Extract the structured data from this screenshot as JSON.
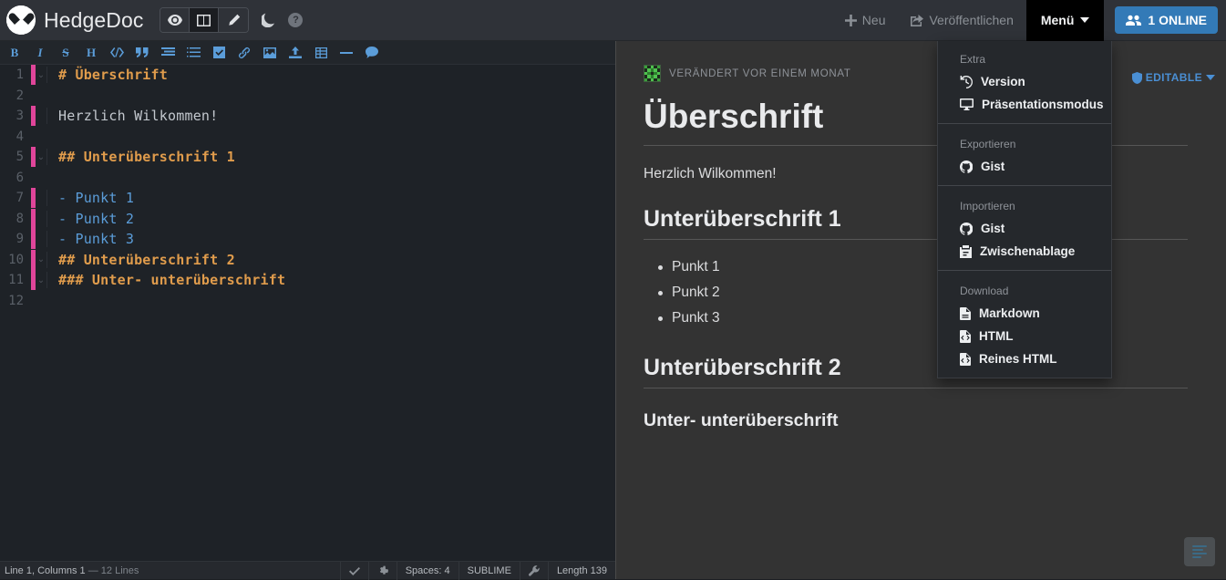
{
  "header": {
    "brand": "HedgeDoc",
    "view_modes": [
      {
        "name": "view-mode-preview",
        "icon": "eye-icon",
        "active": false
      },
      {
        "name": "view-mode-both",
        "icon": "columns-icon",
        "active": true
      },
      {
        "name": "view-mode-edit",
        "icon": "pencil-icon",
        "active": false
      }
    ],
    "night_mode_icon": "moon-icon",
    "help_icon": "question-circle-icon",
    "new_label": "Neu",
    "publish_label": "Veröffentlichen",
    "menu_label": "Menü",
    "online_label": "1 ONLINE",
    "accent_color": "#337ab7"
  },
  "dropdown": {
    "sections": [
      {
        "header": "Extra",
        "items": [
          {
            "label": "Version",
            "icon": "history-icon"
          },
          {
            "label": "Präsentationsmodus",
            "icon": "desktop-icon"
          }
        ]
      },
      {
        "header": "Exportieren",
        "items": [
          {
            "label": "Gist",
            "icon": "github-icon"
          }
        ]
      },
      {
        "header": "Importieren",
        "items": [
          {
            "label": "Gist",
            "icon": "github-icon"
          },
          {
            "label": "Zwischenablage",
            "icon": "clipboard-icon"
          }
        ]
      },
      {
        "header": "Download",
        "items": [
          {
            "label": "Markdown",
            "icon": "file-text-icon"
          },
          {
            "label": "HTML",
            "icon": "file-code-icon"
          },
          {
            "label": "Reines HTML",
            "icon": "file-code-icon"
          }
        ]
      }
    ]
  },
  "toolbar": {
    "buttons": [
      {
        "name": "bold-icon",
        "glyph": "B"
      },
      {
        "name": "italic-icon",
        "glyph": "I"
      },
      {
        "name": "strikethrough-icon",
        "glyph": "S"
      },
      {
        "name": "heading-icon",
        "glyph": "H"
      },
      {
        "name": "code-icon",
        "glyph": "</>"
      },
      {
        "name": "quote-icon",
        "glyph": "”"
      },
      {
        "name": "unordered-list-icon",
        "glyph": ""
      },
      {
        "name": "ordered-list-icon",
        "glyph": ""
      },
      {
        "name": "checkbox-icon",
        "glyph": ""
      },
      {
        "name": "link-icon",
        "glyph": ""
      },
      {
        "name": "image-icon",
        "glyph": ""
      },
      {
        "name": "upload-icon",
        "glyph": ""
      },
      {
        "name": "table-icon",
        "glyph": ""
      },
      {
        "name": "horizontal-rule-icon",
        "glyph": ""
      },
      {
        "name": "comment-icon",
        "glyph": ""
      }
    ]
  },
  "editor": {
    "lines": [
      {
        "n": "1",
        "text": "# Überschrift",
        "type": "heading",
        "modified": true,
        "fold": true
      },
      {
        "n": "2",
        "text": "",
        "type": "text",
        "modified": false,
        "fold": false
      },
      {
        "n": "3",
        "text": "Herzlich Wilkommen!",
        "type": "text",
        "modified": true,
        "fold": false
      },
      {
        "n": "4",
        "text": "",
        "type": "text",
        "modified": false,
        "fold": false
      },
      {
        "n": "5",
        "text": "## Unterüberschrift 1",
        "type": "heading",
        "modified": true,
        "fold": true
      },
      {
        "n": "6",
        "text": "",
        "type": "text",
        "modified": false,
        "fold": false
      },
      {
        "n": "7",
        "text": "- Punkt 1",
        "type": "list",
        "modified": true,
        "fold": false
      },
      {
        "n": "8",
        "text": "- Punkt 2",
        "type": "list",
        "modified": true,
        "fold": false
      },
      {
        "n": "9",
        "text": "- Punkt 3",
        "type": "list",
        "modified": true,
        "fold": false
      },
      {
        "n": "10",
        "text": "## Unterüberschrift 2",
        "type": "heading",
        "modified": true,
        "fold": true
      },
      {
        "n": "11",
        "text": "### Unter- unterüberschrift",
        "type": "heading",
        "modified": true,
        "fold": true
      },
      {
        "n": "12",
        "text": "",
        "type": "text",
        "modified": false,
        "fold": false
      }
    ]
  },
  "statusbar": {
    "cursor": "Line 1, Columns 1",
    "lines_count": "— 12 Lines",
    "check_icon": "check-icon",
    "gear_icon": "gear-icon",
    "spaces": "Spaces: 4",
    "keymap": "SUBLIME",
    "wrench_icon": "wrench-icon",
    "length": "Length 139"
  },
  "preview": {
    "modified_text": "VERÄNDERT VOR EINEM MONAT",
    "avatar": "identicon-avatar",
    "permission_badge": "EDITABLE",
    "permission_icon": "shield-icon",
    "toc_button": "table-of-contents-icon",
    "blocks": [
      {
        "tag": "h1",
        "text": "Überschrift"
      },
      {
        "tag": "p",
        "text": "Herzlich Wilkommen!"
      },
      {
        "tag": "h2",
        "text": "Unterüberschrift 1"
      },
      {
        "tag": "ul",
        "items": [
          "Punkt 1",
          "Punkt 2",
          "Punkt 3"
        ]
      },
      {
        "tag": "h2",
        "text": "Unterüberschrift 2"
      },
      {
        "tag": "h3",
        "text": "Unter- unterüberschrift"
      }
    ]
  }
}
